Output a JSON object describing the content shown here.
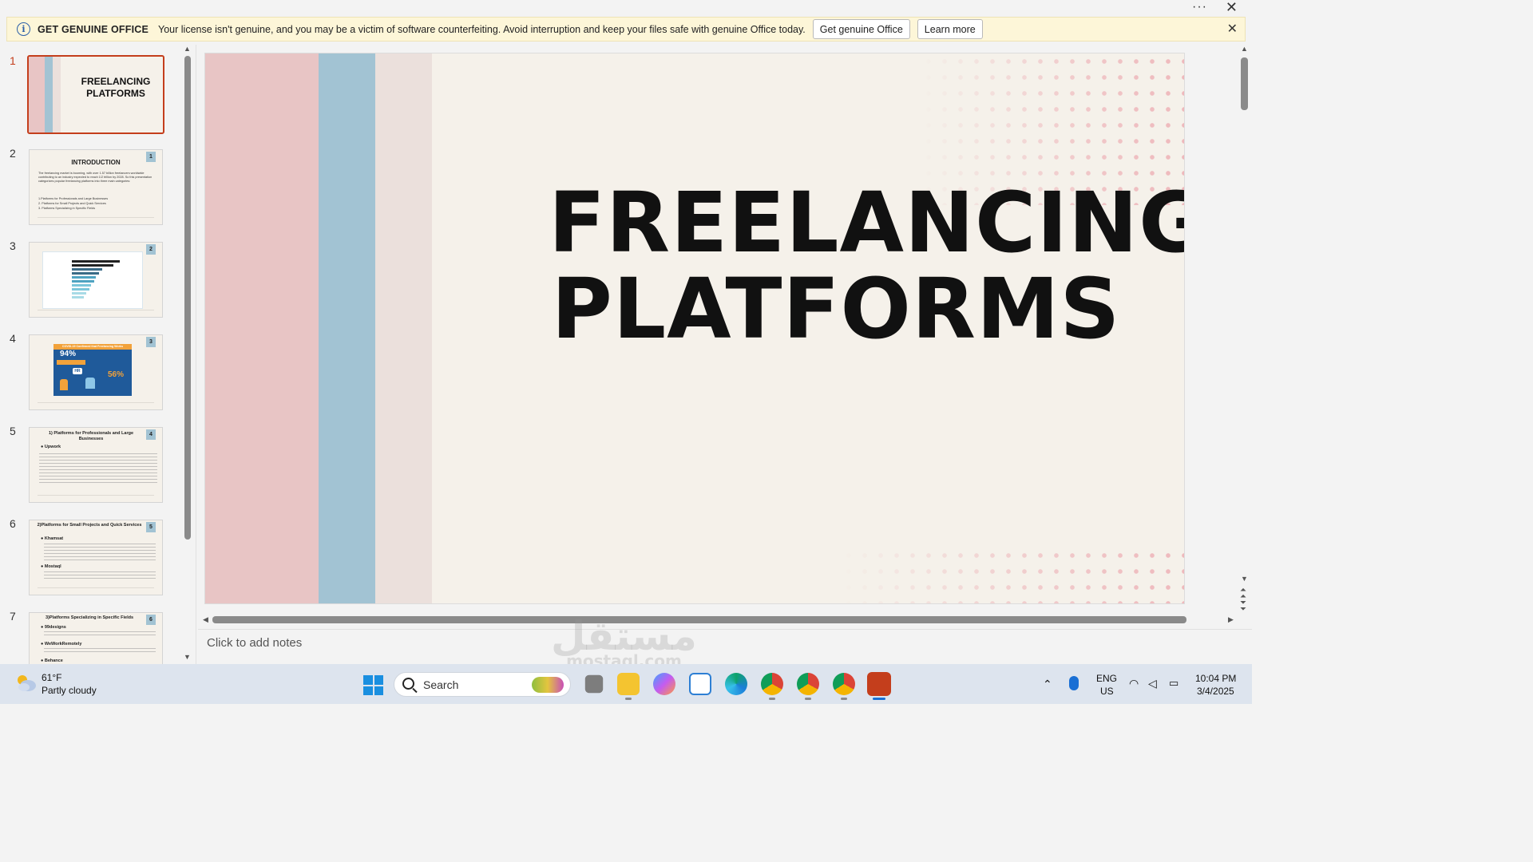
{
  "window": {
    "more_label": "···",
    "close_label": "✕"
  },
  "banner": {
    "title": "GET GENUINE OFFICE",
    "message": "Your license isn't genuine, and you may be a victim of software counterfeiting. Avoid interruption and keep your files safe with genuine Office today.",
    "get_genuine_button": "Get genuine Office",
    "learn_more_button": "Learn more",
    "close_label": "✕"
  },
  "thumbnails": [
    {
      "number": "1",
      "title": "FREELANCING PLATFORMS",
      "active": true
    },
    {
      "number": "2",
      "badge": "1",
      "title": "INTRODUCTION",
      "body": "The freelancing market is booming, with over 1.57 billion freelancers worldwide contributing to an industry expected to reach 1/2 trillion by 2028. So this presentation categorizes popular freelancing platforms into three main categories:",
      "list": [
        "1.Platforms for Professionals and Large Businesses",
        "2. Platforms for Small Projects and Quick Services",
        "3. Platforms Specializing in Specific Fields"
      ]
    },
    {
      "number": "3",
      "badge": "2"
    },
    {
      "number": "4",
      "badge": "3",
      "title": "COVID-19 Confirmed that Freelancing Works",
      "stat1": "94%",
      "stat2": "56%",
      "hr_label": "HR"
    },
    {
      "number": "5",
      "badge": "4",
      "title": "1) Platforms for Professionals and Large Businesses",
      "bullet": "Upwork"
    },
    {
      "number": "6",
      "badge": "5",
      "title": "2)Platforms for Small Projects and Quick Services",
      "bullet1": "Khamsat",
      "bullet2": "Mostaql"
    },
    {
      "number": "7",
      "badge": "6",
      "title": "3)Platforms Specializing in Specific Fields",
      "bullet1": "99designs",
      "bullet2": "WeWorkRemotely",
      "bullet3": "Behance"
    }
  ],
  "slide": {
    "title_line1": "FREELANCING",
    "title_line2": "PLATFORMS",
    "colors": {
      "stripe_pink": "#e8c5c5",
      "stripe_blue": "#a2c3d3",
      "stripe_beige": "#ebe0dc",
      "background": "#f5f1ea",
      "dots": "#eeb8bc"
    }
  },
  "notes": {
    "placeholder": "Click to add notes"
  },
  "watermark": {
    "text": "مستقل",
    "subtext": "mostaql.com"
  },
  "taskbar": {
    "weather": {
      "temp": "61°F",
      "desc": "Partly cloudy"
    },
    "search_label": "Search",
    "apps": [
      "file-manager-icon",
      "file-explorer-icon",
      "copilot-icon",
      "store-icon",
      "edge-icon",
      "chrome-icon",
      "chrome-profile-icon",
      "chrome-profile-n-icon",
      "powerpoint-icon"
    ],
    "language": "ENG",
    "region": "US",
    "time": "10:04 PM",
    "date": "3/4/2025"
  }
}
